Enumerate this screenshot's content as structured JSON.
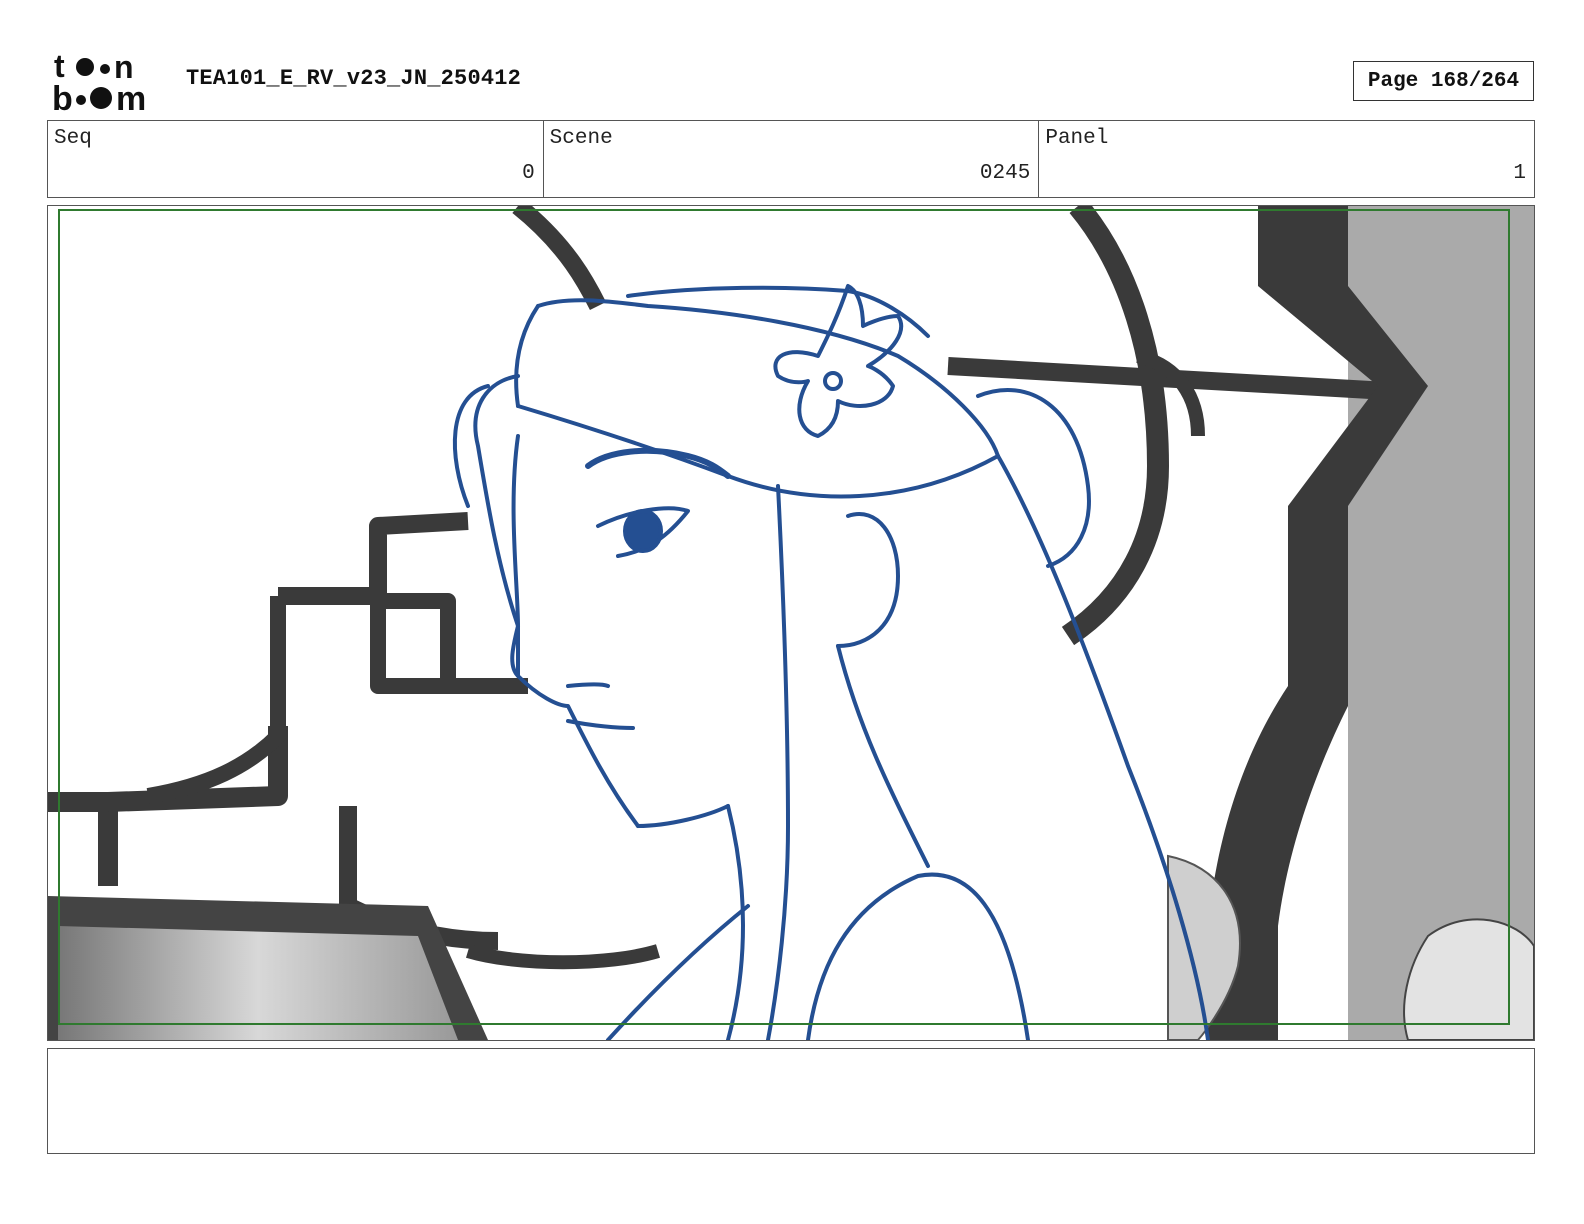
{
  "header": {
    "logo_top": "toon",
    "logo_bottom": "boom",
    "document_title": "TEA101_E_RV_v23_JN_250412",
    "page_label": "Page 168/264"
  },
  "info": {
    "seq_label": "Seq",
    "seq_value": "0",
    "scene_label": "Scene",
    "scene_value": "0245",
    "panel_label": "Panel",
    "panel_value": "1"
  },
  "colors": {
    "sketch_line": "#244f92",
    "background_shade": "#3a3a3a",
    "safe_frame": "#2f7a2f"
  },
  "caption": {
    "text": ""
  }
}
